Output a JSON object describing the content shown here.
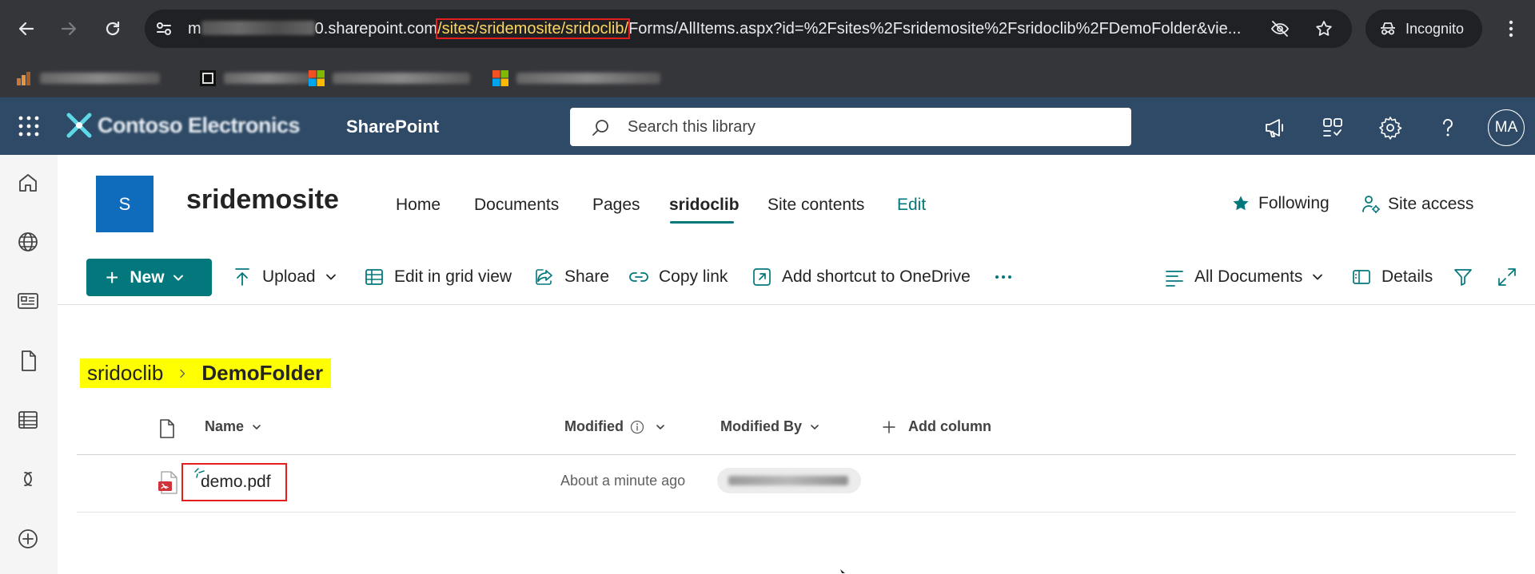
{
  "browser": {
    "url_start": "m",
    "url_domain_end": "0.sharepoint.com",
    "url_highlight": "/sites/sridemosite/sridoclib/",
    "url_rest": "Forms/AllItems.aspx?id=%2Fsites%2Fsridemosite%2Fsridoclib%2FDemoFolder&vie...",
    "incognito_label": "Incognito"
  },
  "suite": {
    "app_name": "SharePoint",
    "search_placeholder": "Search this library",
    "avatar_initials": "MA"
  },
  "site": {
    "logo_letter": "S",
    "name": "sridemosite",
    "nav": [
      "Home",
      "Documents",
      "Pages",
      "sridoclib",
      "Site contents",
      "Edit"
    ],
    "following_label": "Following",
    "site_access_label": "Site access"
  },
  "commands": {
    "new": "New",
    "upload": "Upload",
    "edit_grid": "Edit in grid view",
    "share": "Share",
    "copy_link": "Copy link",
    "add_shortcut": "Add shortcut to OneDrive",
    "view": "All Documents",
    "details": "Details"
  },
  "breadcrumb": {
    "library": "sridoclib",
    "folder": "DemoFolder"
  },
  "columns": {
    "name": "Name",
    "modified": "Modified",
    "modified_by": "Modified By",
    "add_column": "Add column"
  },
  "rows": [
    {
      "name": "demo.pdf",
      "modified": "About a minute ago"
    }
  ],
  "colors": {
    "suite_bar": "#2e4a66",
    "accent": "#03787c",
    "site_logo": "#0f6cbd",
    "highlight": "#ffff00",
    "annotation": "#e41e1e"
  }
}
